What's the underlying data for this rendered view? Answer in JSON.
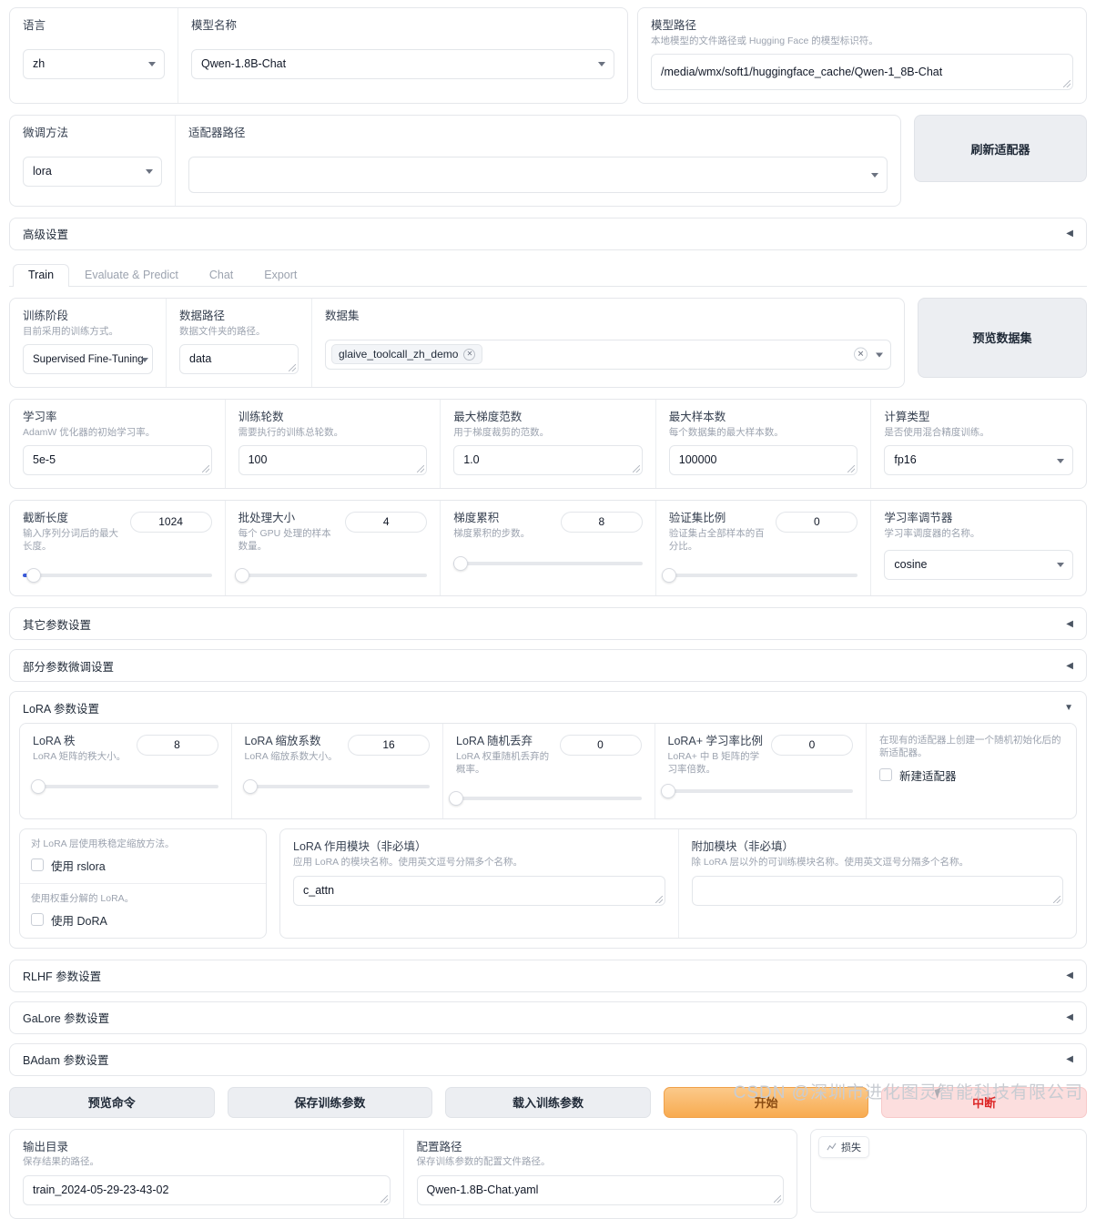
{
  "top": {
    "language": {
      "label": "语言",
      "value": "zh"
    },
    "model_name": {
      "label": "模型名称",
      "value": "Qwen-1.8B-Chat"
    },
    "model_path": {
      "label": "模型路径",
      "hint": "本地模型的文件路径或 Hugging Face 的模型标识符。",
      "value": "/media/wmx/soft1/huggingface_cache/Qwen-1_8B-Chat"
    }
  },
  "second": {
    "finetune_method": {
      "label": "微调方法",
      "value": "lora"
    },
    "adapter_path": {
      "label": "适配器路径",
      "value": ""
    },
    "refresh_adapters_button": "刷新适配器"
  },
  "advanced_accordion": {
    "label": "高级设置",
    "arrow": "◀"
  },
  "tabs": [
    {
      "label": "Train",
      "active": true
    },
    {
      "label": "Evaluate & Predict",
      "active": false
    },
    {
      "label": "Chat",
      "active": false
    },
    {
      "label": "Export",
      "active": false
    }
  ],
  "train": {
    "stage": {
      "label": "训练阶段",
      "hint": "目前采用的训练方式。",
      "value": "Supervised Fine-Tuning"
    },
    "data_dir": {
      "label": "数据路径",
      "hint": "数据文件夹的路径。",
      "value": "data"
    },
    "dataset": {
      "label": "数据集",
      "tags": [
        "glaive_toolcall_zh_demo"
      ]
    },
    "preview_dataset_button": "预览数据集",
    "learning_rate": {
      "label": "学习率",
      "hint": "AdamW 优化器的初始学习率。",
      "value": "5e-5"
    },
    "epochs": {
      "label": "训练轮数",
      "hint": "需要执行的训练总轮数。",
      "value": "100"
    },
    "max_grad_norm": {
      "label": "最大梯度范数",
      "hint": "用于梯度裁剪的范数。",
      "value": "1.0"
    },
    "max_samples": {
      "label": "最大样本数",
      "hint": "每个数据集的最大样本数。",
      "value": "100000"
    },
    "compute_type": {
      "label": "计算类型",
      "hint": "是否使用混合精度训练。",
      "value": "fp16"
    },
    "cutoff_len": {
      "label": "截断长度",
      "hint": "输入序列分词后的最大长度。",
      "value": "1024",
      "pct": 6
    },
    "batch_size": {
      "label": "批处理大小",
      "hint": "每个 GPU 处理的样本数量。",
      "value": "4",
      "pct": 2
    },
    "grad_accum": {
      "label": "梯度累积",
      "hint": "梯度累积的步数。",
      "value": "8",
      "pct": 4
    },
    "val_size": {
      "label": "验证集比例",
      "hint": "验证集占全部样本的百分比。",
      "value": "0",
      "pct": 0
    },
    "lr_scheduler": {
      "label": "学习率调节器",
      "hint": "学习率调度器的名称。",
      "value": "cosine"
    }
  },
  "accordions": [
    {
      "label": "其它参数设置",
      "arrow": "◀"
    },
    {
      "label": "部分参数微调设置",
      "arrow": "◀"
    }
  ],
  "lora": {
    "header": {
      "label": "LoRA 参数设置",
      "arrow": "▼"
    },
    "rank": {
      "label": "LoRA 秩",
      "hint": "LoRA 矩阵的秩大小。",
      "value": "8",
      "pct": 3
    },
    "alpha": {
      "label": "LoRA 缩放系数",
      "hint": "LoRA 缩放系数大小。",
      "value": "16",
      "pct": 3
    },
    "dropout": {
      "label": "LoRA 随机丢弃",
      "hint": "LoRA 权重随机丢弃的概率。",
      "value": "0",
      "pct": 0
    },
    "loraplus_lr_ratio": {
      "label": "LoRA+ 学习率比例",
      "hint": "LoRA+ 中 B 矩阵的学习率倍数。",
      "value": "0",
      "pct": 0
    },
    "create_new_adapter": {
      "hint": "在现有的适配器上创建一个随机初始化后的新适配器。",
      "label": "新建适配器"
    },
    "use_rslora": {
      "hint": "对 LoRA 层使用秩稳定缩放方法。",
      "label": "使用 rslora"
    },
    "use_dora": {
      "hint": "使用权重分解的 LoRA。",
      "label": "使用 DoRA"
    },
    "lora_target": {
      "label": "LoRA 作用模块（非必填）",
      "hint": "应用 LoRA 的模块名称。使用英文逗号分隔多个名称。",
      "value": "c_attn"
    },
    "additional_target": {
      "label": "附加模块（非必填）",
      "hint": "除 LoRA 层以外的可训练模块名称。使用英文逗号分隔多个名称。",
      "value": ""
    }
  },
  "accordions2": [
    {
      "label": "RLHF 参数设置",
      "arrow": "◀"
    },
    {
      "label": "GaLore 参数设置",
      "arrow": "◀"
    },
    {
      "label": "BAdam 参数设置",
      "arrow": "◀"
    }
  ],
  "actions": [
    {
      "label": "预览命令",
      "style": "grey"
    },
    {
      "label": "保存训练参数",
      "style": "grey"
    },
    {
      "label": "载入训练参数",
      "style": "grey"
    },
    {
      "label": "开始",
      "style": "start"
    },
    {
      "label": "中断",
      "style": "abort"
    }
  ],
  "footer": {
    "output_dir": {
      "label": "输出目录",
      "hint": "保存结果的路径。",
      "value": "train_2024-05-29-23-43-02"
    },
    "config_path": {
      "label": "配置路径",
      "hint": "保存训练参数的配置文件路径。",
      "value": "Qwen-1.8B-Chat.yaml"
    },
    "loss_chip": {
      "icon": "chart-icon",
      "label": "损失"
    }
  },
  "watermark": "CSDN @深圳市进化图灵智能科技有限公司",
  "colors": {
    "accent": "#3b5bdb",
    "start": "#f8ab50",
    "abort": "#dc2626",
    "border": "#e5e7eb"
  }
}
